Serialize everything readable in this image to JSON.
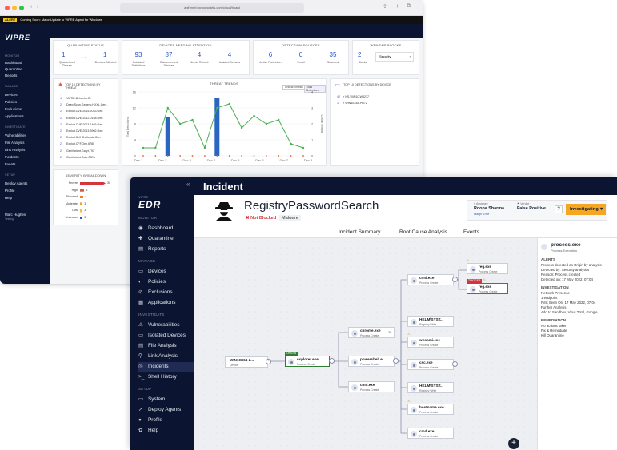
{
  "dashboard": {
    "url": "apif.mmf.mvnomodels.com/cloud/board",
    "alert_badge": "ALERT",
    "alert_text": "Coming Soon: Major Update to VIPRE Agent for Windows",
    "logo": "VIPRE",
    "sidebar": {
      "sections": [
        "MONITOR",
        "MANAGE",
        "INVESTIGATE",
        "SETUP"
      ],
      "items": [
        "Dashboard",
        "Quarantine",
        "Reports",
        "Devices",
        "Policies",
        "Exclusions",
        "Applications",
        "Vulnerabilities",
        "File Analysis",
        "Link Analysis",
        "Incidents",
        "Events",
        "Deploy Agents",
        "Profile",
        "Help"
      ],
      "user": "Marc Hughes",
      "user_sub": "Testing"
    },
    "quarantine_status": {
      "title": "QUARANTINE STATUS",
      "items": [
        {
          "value": "1",
          "label": "Quarantined Threats"
        },
        {
          "value": "1",
          "label": "Devices Affected"
        }
      ]
    },
    "devices_attention": {
      "title": "DEVICES NEEDING ATTENTION",
      "items": [
        {
          "value": "93",
          "label": "Outdated Definitions"
        },
        {
          "value": "87",
          "label": "Disconnected Devices"
        },
        {
          "value": "4",
          "label": "Needs Reboot"
        },
        {
          "value": "4",
          "label": "Isolated Devices"
        }
      ]
    },
    "detection_sources": {
      "title": "DETECTION SOURCES",
      "items": [
        {
          "value": "6",
          "label": "Active Protection"
        },
        {
          "value": "0",
          "label": "Email"
        },
        {
          "value": "35",
          "label": "Scanned"
        }
      ]
    },
    "web_blocks": {
      "title": "WEB/DNS BLOCKS",
      "items": [
        {
          "value": "2",
          "label": "Blocks"
        },
        {
          "value": "Security",
          "label": ""
        }
      ]
    },
    "top_threats": {
      "title": "TOP 10 DETECTIONS BY THREAT",
      "rows": [
        {
          "n": "4",
          "name": "VIPRE.Behavior.Gt"
        },
        {
          "n": "2",
          "name": "Deep.Scan.Generic.HXXL.Gen.."
        },
        {
          "n": "2",
          "name": "Exploit.CVE-2015-2033.Gen"
        },
        {
          "n": "2",
          "name": "Exploit.CVE-2012-0158.Gen"
        },
        {
          "n": "2",
          "name": "Exploit.CVE-2013-1465.Gen"
        },
        {
          "n": "2",
          "name": "Exploit.CVE-2013-3902.Gen"
        },
        {
          "n": "2",
          "name": "Exploit.Self Shellcode.Gen"
        },
        {
          "n": "2",
          "name": "Exploit.CFF.Gen.6780"
        },
        {
          "n": "2",
          "name": "GenVariant.Garyt.T97"
        },
        {
          "n": "2",
          "name": "GenVariant.Rate.38FA"
        }
      ]
    },
    "threat_trends": {
      "title": "THREAT TRENDS",
      "toggle": [
        "Critical Threats",
        "Total Detections"
      ]
    },
    "top_devices": {
      "title": "TOP 10 DETECTIONS BY DEVICE",
      "rows": [
        {
          "n": "42",
          "name": "NS-WIN10-W3217"
        },
        {
          "n": "1",
          "name": "WIN10X64-PR7Z"
        }
      ]
    },
    "severity": {
      "title": "SEVERITY BREAKDOWN",
      "rows": [
        {
          "label": "Severe",
          "value": "30",
          "color": "#d6343d"
        },
        {
          "label": "High",
          "value": "5",
          "color": "#e05a3a"
        },
        {
          "label": "Elevated",
          "value": "4",
          "color": "#f07e2a"
        },
        {
          "label": "Moderate",
          "value": "3",
          "color": "#f1a21d"
        },
        {
          "label": "Low",
          "value": "3",
          "color": "#f2c32c"
        },
        {
          "label": "Unknown",
          "value": "3",
          "color": "#2b54c5"
        }
      ]
    }
  },
  "chart_data": {
    "type": "line",
    "title": "THREAT TRENDS",
    "categories": [
      "Dec 1",
      "Dec 2",
      "Dec 3",
      "Dec 4",
      "Dec 5",
      "Dec 6",
      "Dec 7",
      "Dec 8"
    ],
    "ylim": [
      0,
      16
    ],
    "y2lim": [
      0,
      4
    ],
    "yticks": [
      "0",
      "4",
      "8",
      "12",
      "16"
    ],
    "y2ticks": [
      "0",
      "1",
      "2",
      "3",
      "4"
    ],
    "ylabel": "Total Detections",
    "y2label": "Critical Threats",
    "series": [
      {
        "name": "Total Detections",
        "type": "line",
        "color": "#4caf50",
        "values": [
          2,
          2,
          12,
          8,
          9,
          2,
          12,
          13,
          7,
          10,
          8,
          9,
          3,
          2
        ]
      },
      {
        "name": "Critical Threats",
        "type": "bar",
        "color": "#2b65c2",
        "values": [
          0,
          0,
          2.4,
          0,
          0,
          0,
          3.6,
          0,
          0,
          0,
          0,
          0,
          0,
          0
        ]
      }
    ]
  },
  "edr": {
    "logo_sub": "VIPRE",
    "logo": "EDR",
    "page_title": "Incident",
    "incident_name": "RegistryPasswordSearch",
    "status_badge": "Not Blocked",
    "type_badge": "Malware",
    "assignee_label": "Assignee",
    "assignee": "Roopa Sharma",
    "assign_to_me": "assign to me",
    "verdict_label": "Verdict",
    "verdict": "False Positive",
    "help_glyph": "?",
    "status_button": "Investigating",
    "tabs": [
      "Incident Summary",
      "Root Cause Analysis",
      "Events"
    ],
    "sidebar": {
      "sections": [
        "MONITOR",
        "MANAGE",
        "INVESTIGATE",
        "SETUP"
      ],
      "monitor": [
        "Dashboard",
        "Quarantine",
        "Reports"
      ],
      "manage": [
        "Devices",
        "Policies",
        "Exclusions",
        "Applications"
      ],
      "investigate": [
        "Vulnerabilities",
        "Isolated Devices",
        "File Analysis",
        "Link Analysis",
        "Incidents",
        "Shell History"
      ],
      "setup": [
        "System",
        "Deploy Agents",
        "Profile",
        "Help"
      ]
    },
    "graph": {
      "device": {
        "name": "WIN10X64-2...",
        "sub": "Device"
      },
      "origin_tag": "ORIGIN",
      "trigger_tag": "TRIGGER",
      "explorer": {
        "name": "explorer.exe",
        "sub": "Process Create"
      },
      "chrome": {
        "name": "chrome.exe",
        "sub": "Process Create",
        "count": "36"
      },
      "powershell": {
        "name": "powershell.e...",
        "sub": "Process Create"
      },
      "cmd_low": {
        "name": "cmd.exe",
        "sub": "Process Create"
      },
      "cmd_top": {
        "name": "cmd.exe",
        "sub": "Process Create"
      },
      "reg_top": {
        "name": "reg.exe",
        "sub": "Process Create"
      },
      "reg_trigger": {
        "name": "reg.exe",
        "sub": "Process Create"
      },
      "hklm1": {
        "name": "HKLM\\SYST...",
        "sub": "Registry Write"
      },
      "whoami": {
        "name": "whoami.exe",
        "sub": "Process Create"
      },
      "csc": {
        "name": "csc.exe",
        "sub": "Process Create"
      },
      "hklm2": {
        "name": "HKLM\\SYST...",
        "sub": "Registry Write"
      },
      "hostname": {
        "name": "hostname.exe",
        "sub": "Process Create"
      },
      "cmd_bottom": {
        "name": "cmd.exe",
        "sub": "Process Create"
      },
      "plus": "+",
      "minus": "−"
    },
    "details": {
      "process": "process.exe",
      "process_sub": "Process Execution",
      "alerts_h": "ALERTS",
      "alerts_1": "Process detected as Origin by analysis",
      "alerts_2": "Detected by:   Security analytics",
      "alerts_3": "Reason:          Process created",
      "alerts_4": "Detected on:   17 May 2022, 07:04",
      "inv_h": "INVESTIGATION",
      "inv_1": "Network Presence",
      "inv_2": "1 endpoint",
      "inv_3": "First Seen On:  17 May 2022, 07:04",
      "inv_4": "Further Analysis",
      "inv_5": "Add to Sandbox, Virus Total, Google",
      "rem_h": "REMEDIATION",
      "rem_1": "No actions taken",
      "rem_2": "Fix & Remediate",
      "rem_3": "Kill Quarantine"
    }
  }
}
